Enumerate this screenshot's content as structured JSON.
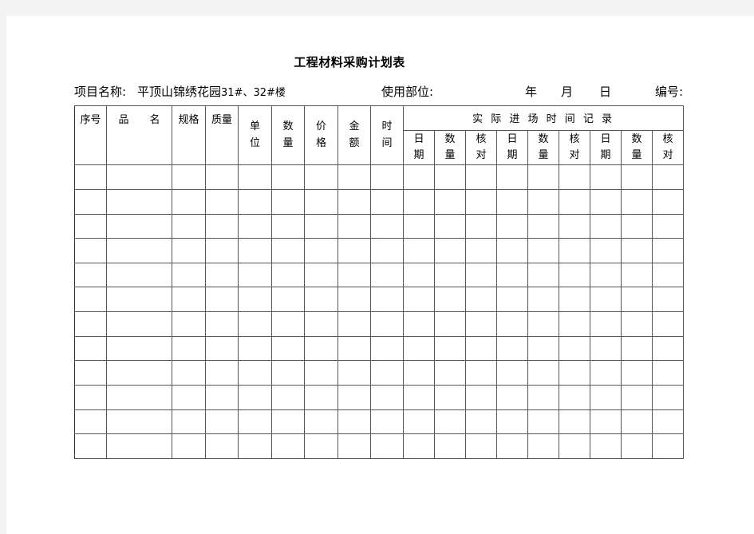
{
  "document": {
    "title": "工程材料采购计划表"
  },
  "meta": {
    "project_label": "项目名称:",
    "project_value": "平顶山锦绣花园 31#、32#楼",
    "project_value_cn": "平顶山锦绣花园",
    "project_value_latin": "31#、32#楼",
    "use_part_label": "使用部位:",
    "year_label": "年",
    "month_label": "月",
    "day_label": "日",
    "number_label": "编号:"
  },
  "table": {
    "left_columns": [
      {
        "key": "seq",
        "label": "序号",
        "orientation": "horizontal"
      },
      {
        "key": "name",
        "label": "品  名",
        "orientation": "horizontal"
      },
      {
        "key": "spec",
        "label": "规格",
        "orientation": "horizontal"
      },
      {
        "key": "quality",
        "label": "质量",
        "orientation": "horizontal"
      },
      {
        "key": "unit",
        "label": "单位",
        "orientation": "vertical",
        "chars": [
          "单",
          "位"
        ]
      },
      {
        "key": "quantity",
        "label": "数量",
        "orientation": "vertical",
        "chars": [
          "数",
          "量"
        ]
      },
      {
        "key": "price",
        "label": "价格",
        "orientation": "vertical",
        "chars": [
          "价",
          "格"
        ]
      },
      {
        "key": "amount",
        "label": "金额",
        "orientation": "vertical",
        "chars": [
          "金",
          "额"
        ]
      },
      {
        "key": "time",
        "label": "时间",
        "orientation": "vertical",
        "chars": [
          "时",
          "间"
        ]
      }
    ],
    "group_header": "实 际 进 场 时 间 记 录",
    "sub_columns": [
      {
        "key": "date1",
        "label": "日期",
        "chars": [
          "日",
          "期"
        ]
      },
      {
        "key": "qty1",
        "label": "数量",
        "chars": [
          "数",
          "量"
        ]
      },
      {
        "key": "check1",
        "label": "核对",
        "chars": [
          "核",
          "对"
        ]
      },
      {
        "key": "date2",
        "label": "日期",
        "chars": [
          "日",
          "期"
        ]
      },
      {
        "key": "qty2",
        "label": "数量",
        "chars": [
          "数",
          "量"
        ]
      },
      {
        "key": "check2",
        "label": "核对",
        "chars": [
          "核",
          "对"
        ]
      },
      {
        "key": "date3",
        "label": "日期",
        "chars": [
          "日",
          "期"
        ]
      },
      {
        "key": "qty3",
        "label": "数量",
        "chars": [
          "数",
          "量"
        ]
      },
      {
        "key": "check3",
        "label": "核对",
        "chars": [
          "核",
          "对"
        ]
      }
    ],
    "body_row_count": 12,
    "body_rows": [
      [
        "",
        "",
        "",
        "",
        "",
        "",
        "",
        "",
        "",
        "",
        "",
        "",
        "",
        "",
        "",
        "",
        "",
        ""
      ],
      [
        "",
        "",
        "",
        "",
        "",
        "",
        "",
        "",
        "",
        "",
        "",
        "",
        "",
        "",
        "",
        "",
        "",
        ""
      ],
      [
        "",
        "",
        "",
        "",
        "",
        "",
        "",
        "",
        "",
        "",
        "",
        "",
        "",
        "",
        "",
        "",
        "",
        ""
      ],
      [
        "",
        "",
        "",
        "",
        "",
        "",
        "",
        "",
        "",
        "",
        "",
        "",
        "",
        "",
        "",
        "",
        "",
        ""
      ],
      [
        "",
        "",
        "",
        "",
        "",
        "",
        "",
        "",
        "",
        "",
        "",
        "",
        "",
        "",
        "",
        "",
        "",
        ""
      ],
      [
        "",
        "",
        "",
        "",
        "",
        "",
        "",
        "",
        "",
        "",
        "",
        "",
        "",
        "",
        "",
        "",
        "",
        ""
      ],
      [
        "",
        "",
        "",
        "",
        "",
        "",
        "",
        "",
        "",
        "",
        "",
        "",
        "",
        "",
        "",
        "",
        "",
        ""
      ],
      [
        "",
        "",
        "",
        "",
        "",
        "",
        "",
        "",
        "",
        "",
        "",
        "",
        "",
        "",
        "",
        "",
        "",
        ""
      ],
      [
        "",
        "",
        "",
        "",
        "",
        "",
        "",
        "",
        "",
        "",
        "",
        "",
        "",
        "",
        "",
        "",
        "",
        ""
      ],
      [
        "",
        "",
        "",
        "",
        "",
        "",
        "",
        "",
        "",
        "",
        "",
        "",
        "",
        "",
        "",
        "",
        "",
        ""
      ],
      [
        "",
        "",
        "",
        "",
        "",
        "",
        "",
        "",
        "",
        "",
        "",
        "",
        "",
        "",
        "",
        "",
        "",
        ""
      ],
      [
        "",
        "",
        "",
        "",
        "",
        "",
        "",
        "",
        "",
        "",
        "",
        "",
        "",
        "",
        "",
        "",
        "",
        ""
      ]
    ]
  },
  "colors": {
    "page_background": "#ffffff",
    "canvas_background": "#f4f4f4",
    "grid_line": "#555555",
    "text": "#000000"
  }
}
